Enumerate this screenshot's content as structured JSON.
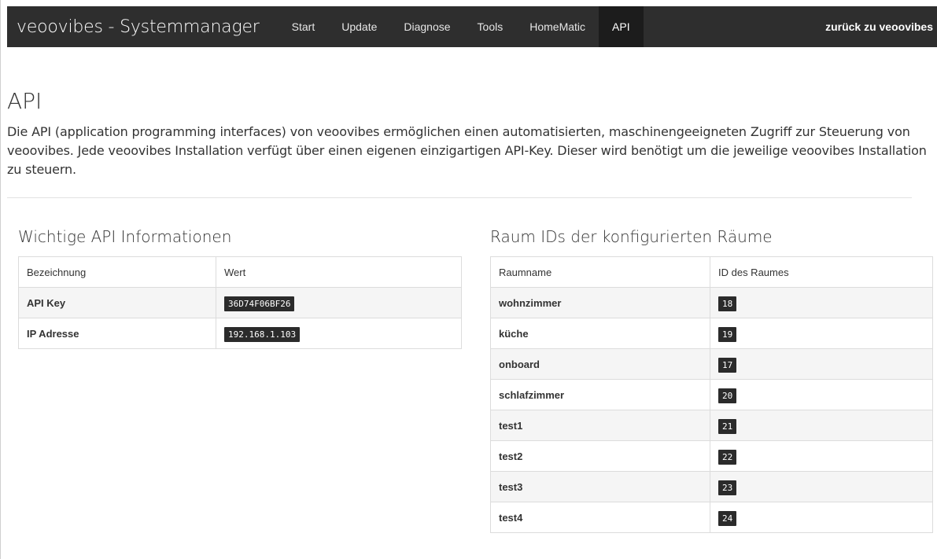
{
  "nav": {
    "brand": "veoovibes - Systemmanager",
    "items": [
      {
        "label": "Start",
        "active": false
      },
      {
        "label": "Update",
        "active": false
      },
      {
        "label": "Diagnose",
        "active": false
      },
      {
        "label": "Tools",
        "active": false
      },
      {
        "label": "HomeMatic",
        "active": false
      },
      {
        "label": "API",
        "active": true
      }
    ],
    "back_link": "zurück zu veoovibes"
  },
  "page": {
    "title": "API",
    "intro": "Die API (application programming interfaces) von veoovibes ermöglichen einen automatisierten, maschinengeeigneten Zugriff zur Steuerung von veoovibes. Jede veoovibes Installation verfügt über einen eigenen einzigartigen API-Key. Dieser wird benötigt um die jeweilige veoovibes Installation zu steuern."
  },
  "api_info": {
    "title": "Wichtige API Informationen",
    "columns": [
      "Bezeichnung",
      "Wert"
    ],
    "rows": [
      {
        "label": "API Key",
        "value": "36D74F06BF26"
      },
      {
        "label": "IP Adresse",
        "value": "192.168.1.103"
      }
    ]
  },
  "rooms": {
    "title": "Raum IDs der konfigurierten Räume",
    "columns": [
      "Raumname",
      "ID des Raumes"
    ],
    "rows": [
      {
        "name": "wohnzimmer",
        "id": "18"
      },
      {
        "name": "küche",
        "id": "19"
      },
      {
        "name": "onboard",
        "id": "17"
      },
      {
        "name": "schlafzimmer",
        "id": "20"
      },
      {
        "name": "test1",
        "id": "21"
      },
      {
        "name": "test2",
        "id": "22"
      },
      {
        "name": "test3",
        "id": "23"
      },
      {
        "name": "test4",
        "id": "24"
      }
    ]
  }
}
